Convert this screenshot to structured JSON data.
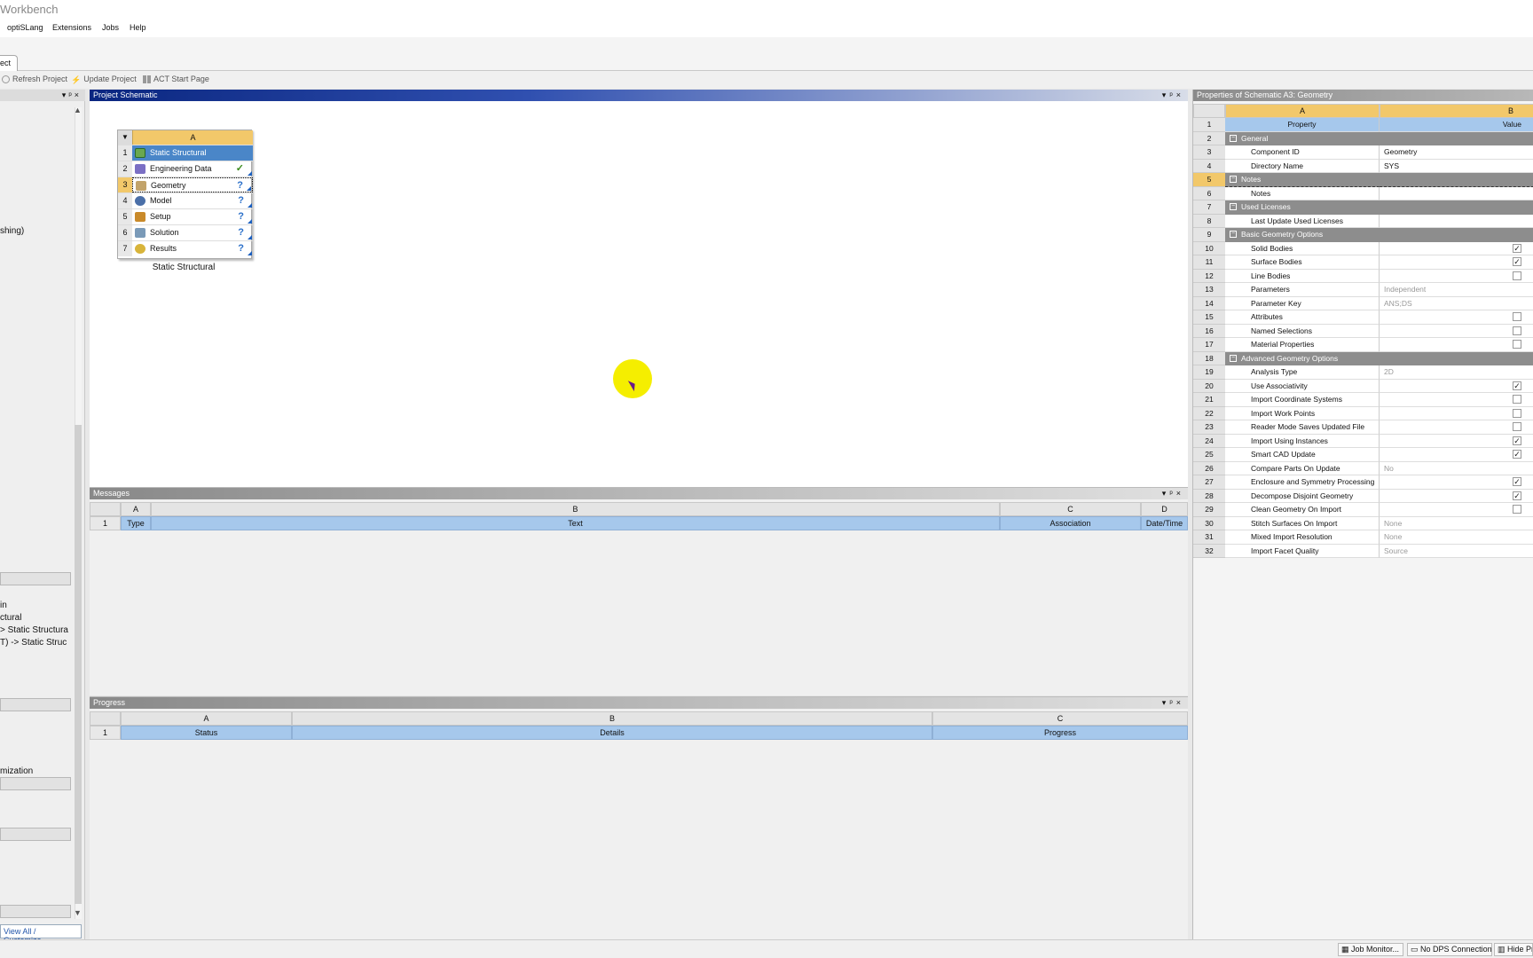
{
  "app": {
    "title": "Workbench"
  },
  "menu": [
    "optiSLang",
    "Extensions",
    "Jobs",
    "Help"
  ],
  "tab": {
    "label": "ect"
  },
  "toolbar": {
    "refresh": "Refresh Project",
    "update": "Update Project",
    "act": "ACT Start Page"
  },
  "toolbox": {
    "texts": [
      "shing)",
      "in",
      "ctural",
      "> Static Structura",
      "T) -> Static Struc",
      "mization"
    ],
    "view_all": "View All / Customize..."
  },
  "schematic": {
    "title": "Project Schematic",
    "column": "A",
    "rows": [
      {
        "num": "1",
        "label": "Static Structural",
        "status": ""
      },
      {
        "num": "2",
        "label": "Engineering Data",
        "status": "✓"
      },
      {
        "num": "3",
        "label": "Geometry",
        "status": "?"
      },
      {
        "num": "4",
        "label": "Model",
        "status": "?"
      },
      {
        "num": "5",
        "label": "Setup",
        "status": "?"
      },
      {
        "num": "6",
        "label": "Solution",
        "status": "?"
      },
      {
        "num": "7",
        "label": "Results",
        "status": "?"
      }
    ],
    "caption": "Static Structural"
  },
  "messages": {
    "title": "Messages",
    "cols": [
      "A",
      "B",
      "C",
      "D"
    ],
    "headers": [
      "Type",
      "Text",
      "Association",
      "Date/Time"
    ],
    "row_num": "1"
  },
  "progress": {
    "title": "Progress",
    "cols": [
      "A",
      "B",
      "C"
    ],
    "headers": [
      "Status",
      "Details",
      "Progress"
    ],
    "row_num": "1"
  },
  "properties": {
    "title": "Properties of Schematic A3: Geometry",
    "cols": [
      "A",
      "B"
    ],
    "rows": [
      {
        "n": "1",
        "kind": "hdr",
        "a": "Property",
        "b": "Value"
      },
      {
        "n": "2",
        "kind": "group",
        "a": "General",
        "b": ""
      },
      {
        "n": "3",
        "kind": "item",
        "a": "Component ID",
        "b": "Geometry"
      },
      {
        "n": "4",
        "kind": "item",
        "a": "Directory Name",
        "b": "SYS"
      },
      {
        "n": "5",
        "kind": "group",
        "a": "Notes",
        "b": "",
        "sel": true
      },
      {
        "n": "6",
        "kind": "item",
        "a": "Notes",
        "b": ""
      },
      {
        "n": "7",
        "kind": "group",
        "a": "Used Licenses",
        "b": ""
      },
      {
        "n": "8",
        "kind": "item",
        "a": "Last Update Used Licenses",
        "b": ""
      },
      {
        "n": "9",
        "kind": "group",
        "a": "Basic Geometry Options",
        "b": ""
      },
      {
        "n": "10",
        "kind": "item",
        "a": "Solid Bodies",
        "chk": "checked"
      },
      {
        "n": "11",
        "kind": "item",
        "a": "Surface Bodies",
        "chk": "checked"
      },
      {
        "n": "12",
        "kind": "item",
        "a": "Line Bodies",
        "chk": "unchecked"
      },
      {
        "n": "13",
        "kind": "item",
        "a": "Parameters",
        "b": "Independent",
        "grey": true
      },
      {
        "n": "14",
        "kind": "item",
        "a": "Parameter Key",
        "b": "ANS;DS",
        "grey": true
      },
      {
        "n": "15",
        "kind": "item",
        "a": "Attributes",
        "chk": "unchecked"
      },
      {
        "n": "16",
        "kind": "item",
        "a": "Named Selections",
        "chk": "unchecked"
      },
      {
        "n": "17",
        "kind": "item",
        "a": "Material Properties",
        "chk": "unchecked"
      },
      {
        "n": "18",
        "kind": "group",
        "a": "Advanced Geometry Options",
        "b": ""
      },
      {
        "n": "19",
        "kind": "item",
        "a": "Analysis Type",
        "b": "2D",
        "grey": true
      },
      {
        "n": "20",
        "kind": "item",
        "a": "Use Associativity",
        "chk": "checked"
      },
      {
        "n": "21",
        "kind": "item",
        "a": "Import Coordinate Systems",
        "chk": "unchecked"
      },
      {
        "n": "22",
        "kind": "item",
        "a": "Import Work Points",
        "chk": "unchecked"
      },
      {
        "n": "23",
        "kind": "item",
        "a": "Reader Mode Saves Updated File",
        "chk": "unchecked"
      },
      {
        "n": "24",
        "kind": "item",
        "a": "Import Using Instances",
        "chk": "checked"
      },
      {
        "n": "25",
        "kind": "item",
        "a": "Smart CAD Update",
        "chk": "checked"
      },
      {
        "n": "26",
        "kind": "item",
        "a": "Compare Parts On Update",
        "b": "No",
        "grey": true
      },
      {
        "n": "27",
        "kind": "item",
        "a": "Enclosure and Symmetry Processing",
        "chk": "checked"
      },
      {
        "n": "28",
        "kind": "item",
        "a": "Decompose Disjoint Geometry",
        "chk": "checked"
      },
      {
        "n": "29",
        "kind": "item",
        "a": "Clean Geometry On Import",
        "chk": "unchecked"
      },
      {
        "n": "30",
        "kind": "item",
        "a": "Stitch Surfaces On Import",
        "b": "None",
        "grey": true
      },
      {
        "n": "31",
        "kind": "item",
        "a": "Mixed Import Resolution",
        "b": "None",
        "grey": true
      },
      {
        "n": "32",
        "kind": "item",
        "a": "Import Facet Quality",
        "b": "Source",
        "grey": true
      }
    ]
  },
  "statusbar": {
    "job_monitor": "Job Monitor...",
    "dps": "No DPS Connection",
    "hide": "Hide Pro"
  },
  "colors": {
    "schematic_header": "#0a2680",
    "column_header": "#f2c86a",
    "grid_header": "#a6c8ec",
    "group_row": "#8d8d8d",
    "cursor_highlight": "#f5ee00"
  }
}
